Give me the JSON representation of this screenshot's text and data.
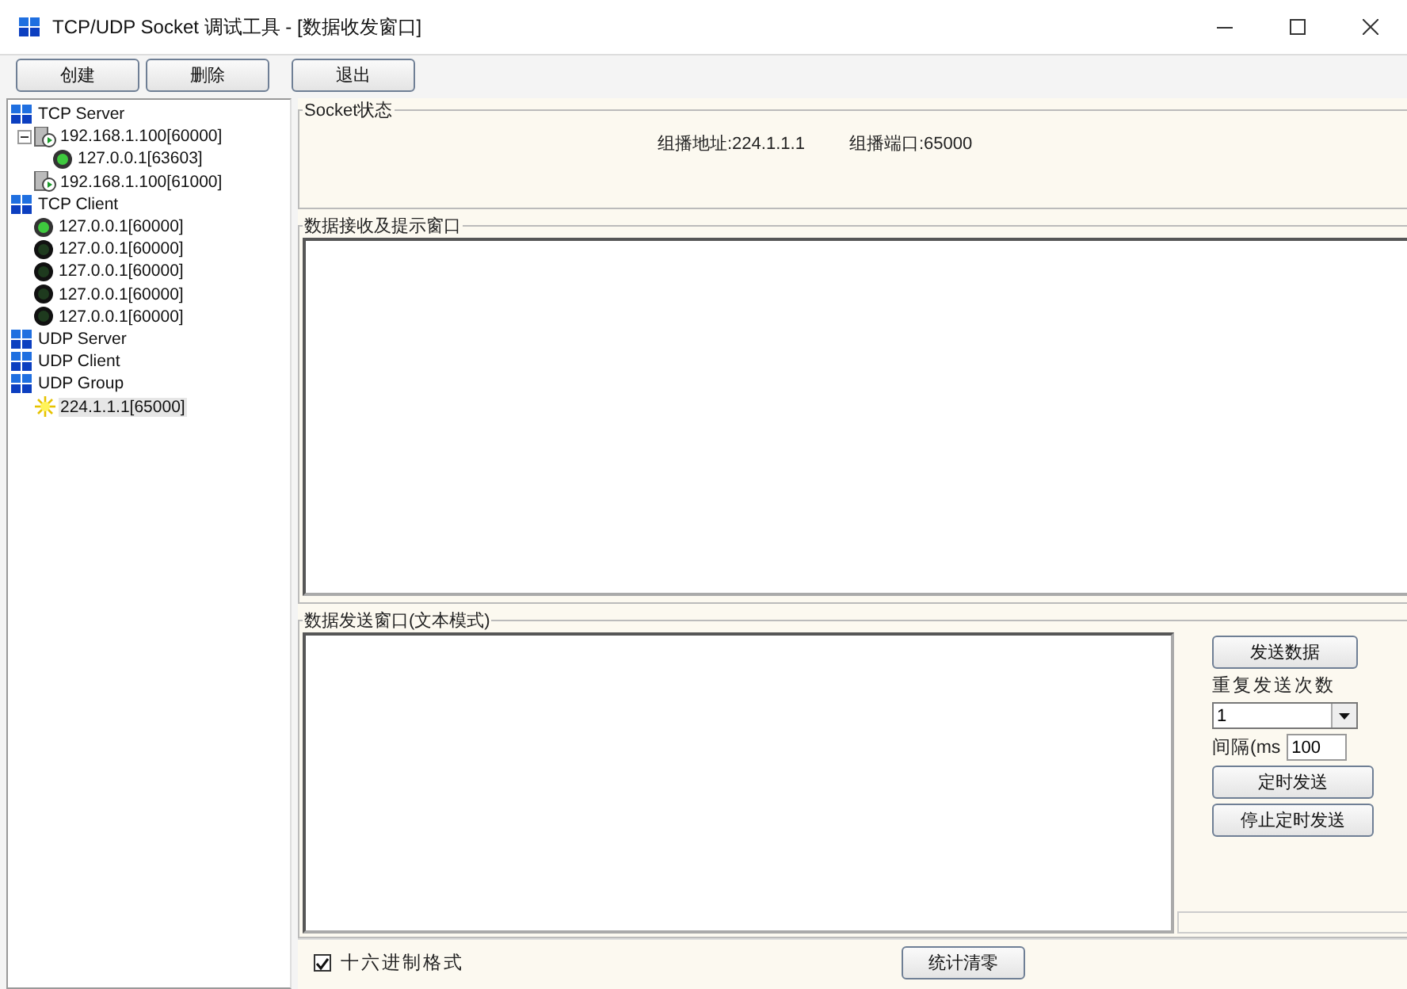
{
  "window": {
    "title": "TCP/UDP Socket 调试工具 - [数据收发窗口]"
  },
  "toolbar": [
    "创建",
    "删除",
    "退出"
  ],
  "tree": [
    {
      "label": "TCP Server",
      "kind": "group",
      "children": [
        {
          "label": "192.168.1.100[60000]",
          "kind": "server",
          "children": [
            {
              "label": "127.0.0.1[63603]",
              "kind": "connected"
            }
          ]
        },
        {
          "label": "192.168.1.100[61000]",
          "kind": "server"
        }
      ]
    },
    {
      "label": "TCP Client",
      "kind": "group",
      "children": [
        {
          "label": "127.0.0.1[60000]",
          "kind": "connected"
        },
        {
          "label": "127.0.0.1[60000]",
          "kind": "idle"
        },
        {
          "label": "127.0.0.1[60000]",
          "kind": "idle"
        },
        {
          "label": "127.0.0.1[60000]",
          "kind": "idle"
        },
        {
          "label": "127.0.0.1[60000]",
          "kind": "idle"
        }
      ]
    },
    {
      "label": "UDP Server",
      "kind": "group"
    },
    {
      "label": "UDP Client",
      "kind": "group"
    },
    {
      "label": "UDP Group",
      "kind": "group",
      "children": [
        {
          "label": "224.1.1.1[65000]",
          "kind": "multicast",
          "selected": true
        }
      ]
    }
  ],
  "status": {
    "title": "Socket状态",
    "address": "组播地址:224.1.1.1",
    "port": "组播端口:65000"
  },
  "receive": {
    "title": "数据接收及提示窗口"
  },
  "send": {
    "title": "数据发送窗口(文本模式)",
    "send_button": "发送数据",
    "repeat_label": "重复发送次数",
    "repeat_value": "1",
    "interval_label": "间隔(ms",
    "interval_value": "100",
    "timer_button": "定时发送",
    "stop_button": "停止定时发送"
  },
  "bottom": {
    "hex_label": "十六进制格式",
    "hex_checked": true,
    "reset_button": "统计清零"
  }
}
